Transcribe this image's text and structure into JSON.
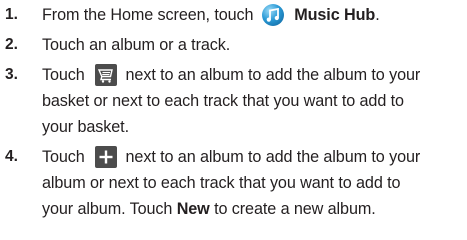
{
  "steps": [
    {
      "number": "1.",
      "line1_before": "From the Home screen, touch",
      "icon": "music-hub-icon",
      "line1_app": "Music Hub",
      "line1_after": "."
    },
    {
      "number": "2.",
      "line1": "Touch an album or a track."
    },
    {
      "number": "3.",
      "line1_before": "Touch",
      "icon": "basket-icon",
      "line1_after": "next to an album to add the album to your",
      "line2": "basket or next to each track that you want to add to",
      "line3": "your basket."
    },
    {
      "number": "4.",
      "line1_before": "Touch",
      "icon": "plus-icon",
      "line1_after": "next to an album to add the album to your",
      "line2": "album or next to each track that you want to add to",
      "line3_before": "your album. Touch",
      "line3_bold": "New",
      "line3_after": "to create a new album."
    }
  ],
  "colors": {
    "text": "#231f20",
    "icon_bg": "#4c4c4c",
    "music_hub_blue": "#2a9ad6"
  }
}
